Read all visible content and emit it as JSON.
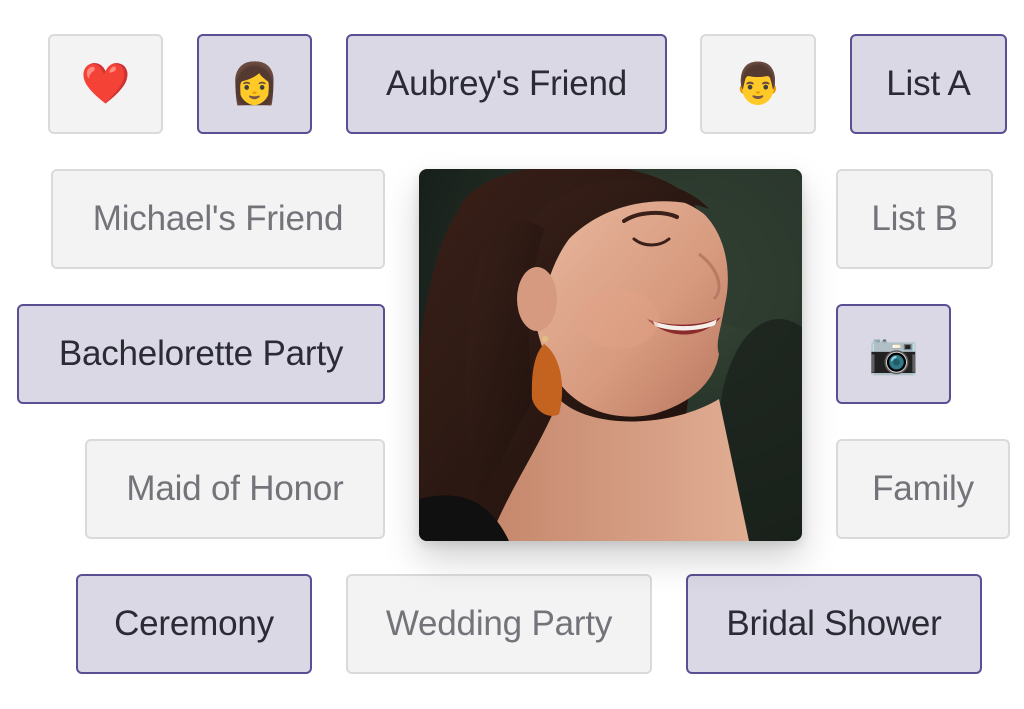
{
  "tags": {
    "heart": {
      "icon": "heart-icon",
      "glyph": "❤️"
    },
    "woman": {
      "icon": "woman-icon",
      "glyph": "👩"
    },
    "aubreys_friend": "Aubrey's Friend",
    "man": {
      "icon": "man-icon",
      "glyph": "👨"
    },
    "list_a": "List A",
    "michaels_friend": "Michael's Friend",
    "list_b": "List B",
    "bachelorette_party": "Bachelorette Party",
    "camera": {
      "icon": "camera-icon",
      "glyph": "📷"
    },
    "maid_of_honor": "Maid of Honor",
    "family": "Family",
    "ceremony": "Ceremony",
    "wedding_party": "Wedding Party",
    "bridal_shower": "Bridal Shower"
  },
  "colors": {
    "selected_fill": "#d9d8e4",
    "selected_border": "#5b4f94",
    "unselected_fill": "#f3f3f3",
    "unselected_border": "#dadada"
  }
}
